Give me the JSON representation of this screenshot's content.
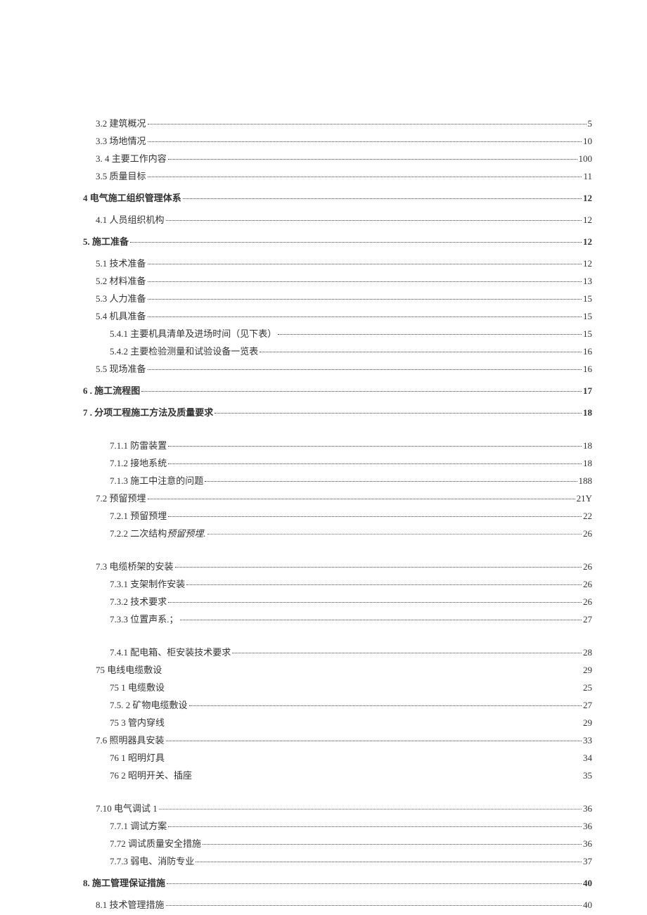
{
  "entries": [
    {
      "label": "3.2 建筑概况",
      "page": "5",
      "indent": 1,
      "bold": false,
      "dots": true
    },
    {
      "label": "3.3 场地情况",
      "page": "10",
      "indent": 1,
      "bold": false,
      "dots": true
    },
    {
      "label": "3.    4 主要工作内容",
      "page": "100",
      "indent": 1,
      "bold": false,
      "dots": true
    },
    {
      "label": "3.5 质量目标",
      "page": "11",
      "indent": 1,
      "bold": false,
      "dots": true
    },
    {
      "label": "4 电气施工组织管理体系",
      "page": "12",
      "indent": 0,
      "bold": true,
      "dots": true,
      "gap": true
    },
    {
      "label": "4.1 人员组织机构",
      "page": "12",
      "indent": 1,
      "bold": false,
      "dots": true,
      "gap": true
    },
    {
      "label": "5. 施工准备",
      "page": "12",
      "indent": 0,
      "bold": true,
      "dots": true,
      "gap": true
    },
    {
      "label": "5.1 技术准备",
      "page": "12",
      "indent": 1,
      "bold": false,
      "dots": true,
      "gap": true
    },
    {
      "label": "5.2 材料准备",
      "page": "13",
      "indent": 1,
      "bold": false,
      "dots": true
    },
    {
      "label": "5.3 人力准备",
      "page": "15",
      "indent": 1,
      "bold": false,
      "dots": true
    },
    {
      "label": "5.4 机具准备",
      "page": "15",
      "indent": 1,
      "bold": false,
      "dots": true
    },
    {
      "label": "5.4.1 主要机具清单及进场时间（见下表）",
      "page": "15",
      "indent": 2,
      "bold": false,
      "dots": true
    },
    {
      "label": "5.4.2 主要检验测量和试验设备一览表",
      "page": "16",
      "indent": 2,
      "bold": false,
      "dots": true
    },
    {
      "label": "5.5 现场准备",
      "page": "16",
      "indent": 1,
      "bold": false,
      "dots": true
    },
    {
      "label": "6     . 施工流程图",
      "page": "17",
      "indent": 0,
      "bold": true,
      "dots": true,
      "gap": true
    },
    {
      "label": "7     . 分项工程施工方法及质量要求",
      "page": "18",
      "indent": 0,
      "bold": true,
      "dots": true,
      "gap": true
    },
    {
      "label": "7.1.1 防雷装置",
      "page": "18",
      "indent": 2,
      "bold": false,
      "dots": true,
      "gap_large": true
    },
    {
      "label": "7.1.2 接地系统",
      "page": "18",
      "indent": 2,
      "bold": false,
      "dots": true
    },
    {
      "label": "7.1.3 施工中注意的问题",
      "page": "188",
      "indent": 2,
      "bold": false,
      "dots": true
    },
    {
      "label": "7.2 预留预埋",
      "page": "21Y",
      "indent": 1,
      "bold": false,
      "dots": true
    },
    {
      "label": "7.2.1 预留预埋",
      "page": "22",
      "indent": 2,
      "bold": false,
      "dots": true
    },
    {
      "label": "7.2.2 二次结构",
      "label_italic": "预留预埋.",
      "page": "26",
      "indent": 2,
      "bold": false,
      "dots": "thin"
    },
    {
      "label": "7.3 电缆桥架的安装",
      "page": "26",
      "indent": 1,
      "bold": false,
      "dots": true,
      "gap_large": true
    },
    {
      "label": "7.3.1 支架制作安装",
      "page": "26",
      "indent": 2,
      "bold": false,
      "dots": true
    },
    {
      "label": "7.3.2 技术要求",
      "page": "26",
      "indent": 2,
      "bold": false,
      "dots": true
    },
    {
      "label": "7.3.3 位置声系.；",
      "page": "27",
      "indent": 2,
      "bold": false,
      "dots": true
    },
    {
      "label": "7.4.1 配电箱、柜安装技术要求",
      "page": "28",
      "indent": 2,
      "bold": false,
      "dots": true,
      "gap_large": true
    },
    {
      "label": "75 电线电缆敷设",
      "page": "29",
      "indent": 1,
      "bold": false,
      "dots": false
    },
    {
      "label": "75      1 电缆敷设",
      "page": "25",
      "indent": 2,
      "bold": false,
      "dots": false
    },
    {
      "label": "7.5.     2 矿物电缆敷设",
      "page": "27",
      "indent": 2,
      "bold": false,
      "dots": true
    },
    {
      "label": "75     3 管内穿线",
      "page": "29",
      "indent": 2,
      "bold": false,
      "dots": false
    },
    {
      "label": "7.6 照明器具安装",
      "page": "33",
      "indent": 1,
      "bold": false,
      "dots": true
    },
    {
      "label": "76     1 昭明灯具",
      "page": "34",
      "indent": 2,
      "bold": false,
      "dots": false
    },
    {
      "label": "76     2 昭明开关、插座",
      "page": "35",
      "indent": 2,
      "bold": false,
      "dots": false
    },
    {
      "label": "7.10 电气调试 1",
      "page": "36",
      "indent": 1,
      "bold": false,
      "dots": "thin",
      "gap_large": true
    },
    {
      "label": "7.7.1 调试方案",
      "page": "36",
      "indent": 2,
      "bold": false,
      "dots": true
    },
    {
      "label": "7.72 调试质量安全措施",
      "page": "36",
      "indent": 2,
      "bold": false,
      "dots": true
    },
    {
      "label": "7.7.3 弱电、消防专业",
      "page": "37",
      "indent": 2,
      "bold": false,
      "dots": true
    },
    {
      "label": "8. 施工管理保证措施",
      "page": "40",
      "indent": 0,
      "bold": true,
      "dots": true,
      "gap": true
    },
    {
      "label": "8.1 技术管理措施",
      "page": "40",
      "indent": 1,
      "bold": false,
      "dots": true,
      "gap": true
    }
  ]
}
